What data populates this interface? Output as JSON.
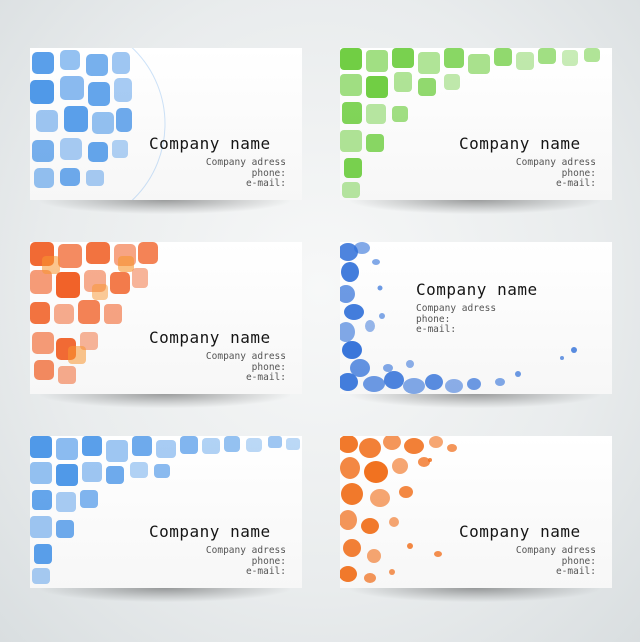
{
  "cards": [
    {
      "company": "Company name",
      "address": "Company adress",
      "phone": "phone:",
      "email": "e-mail:",
      "color": "#3d8ee6",
      "pattern": "squares-sphere"
    },
    {
      "company": "Company name",
      "address": "Company adress",
      "phone": "phone:",
      "email": "e-mail:",
      "color": "#62c930",
      "pattern": "squares-arc"
    },
    {
      "company": "Company name",
      "address": "Company adress",
      "phone": "phone:",
      "email": "e-mail:",
      "color": "#f05a1e",
      "pattern": "squares-wave"
    },
    {
      "company": "Company name",
      "address": "Company adress",
      "phone": "phone:",
      "email": "e-mail:",
      "color": "#2f6fd8",
      "pattern": "blobs-frame"
    },
    {
      "company": "Company name",
      "address": "Company adress",
      "phone": "phone:",
      "email": "e-mail:",
      "color": "#3d8ee6",
      "pattern": "squares-wave"
    },
    {
      "company": "Company name",
      "address": "Company adress",
      "phone": "phone:",
      "email": "e-mail:",
      "color": "#f06a14",
      "pattern": "blobs-drip"
    }
  ]
}
